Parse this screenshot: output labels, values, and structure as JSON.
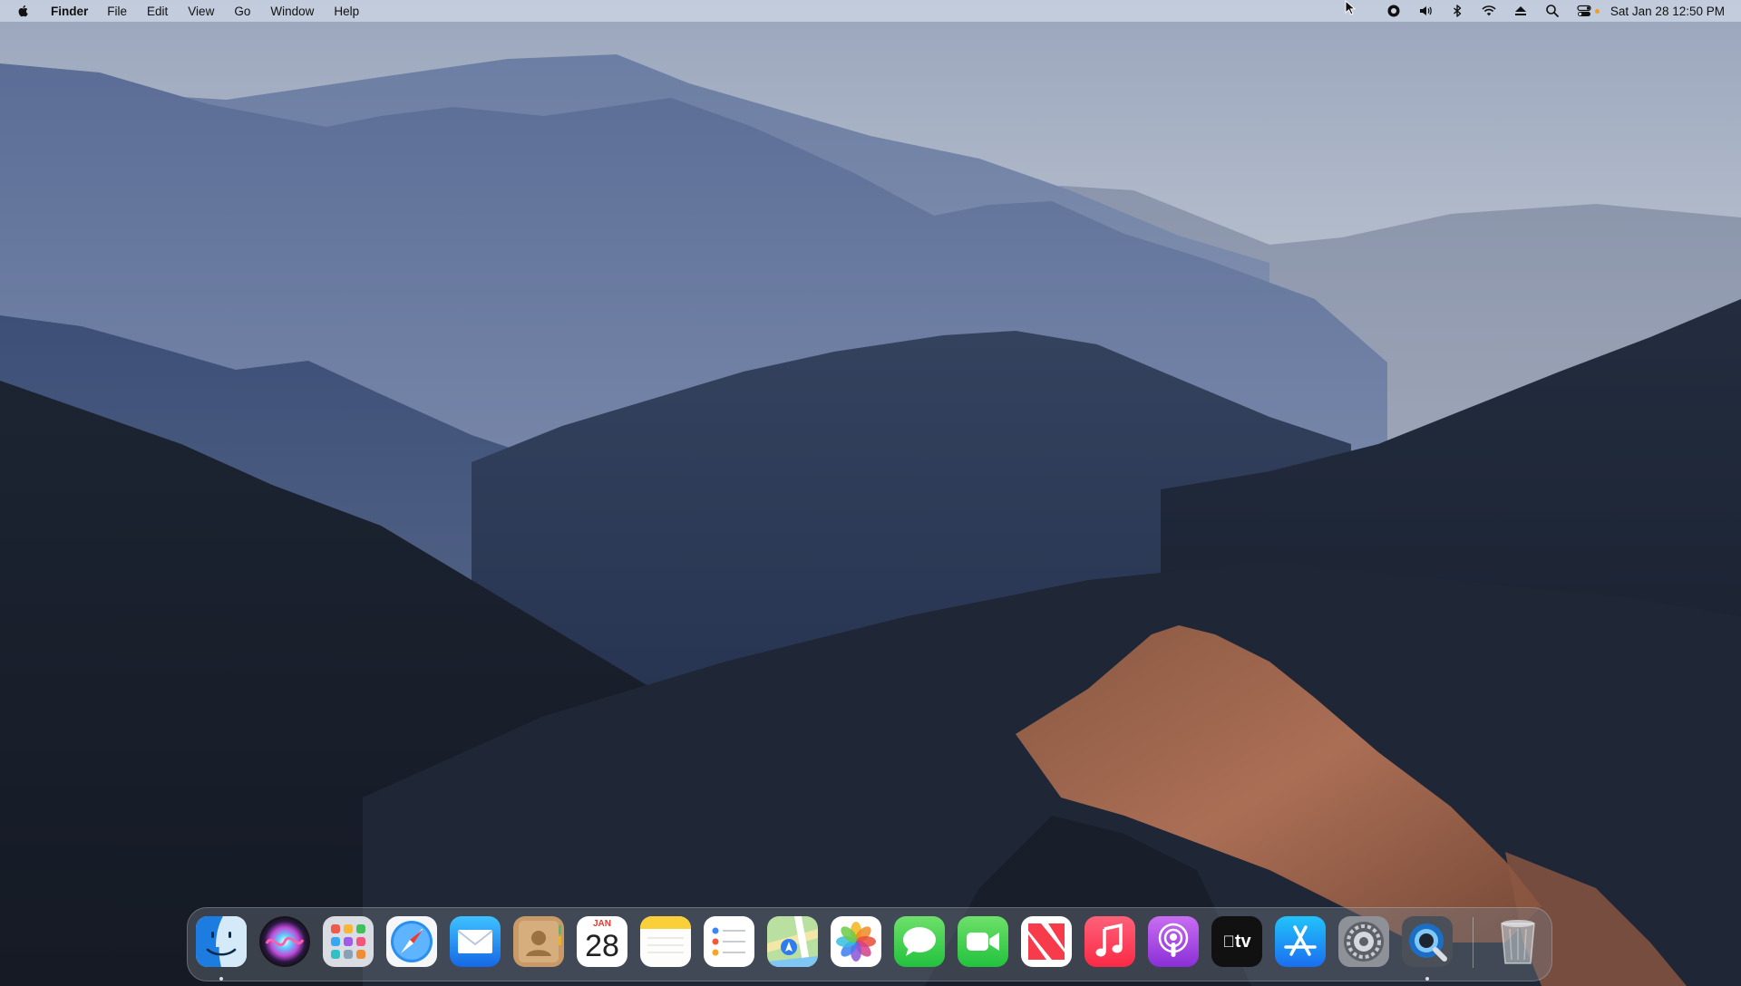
{
  "menubar": {
    "app_name": "Finder",
    "menus": [
      "File",
      "Edit",
      "View",
      "Go",
      "Window",
      "Help"
    ],
    "status_icons": [
      "screen-record-icon",
      "volume-icon",
      "bluetooth-icon",
      "wifi-icon",
      "eject-icon",
      "spotlight-search-icon",
      "control-center-icon"
    ],
    "clock": "Sat Jan 28  12:50 PM"
  },
  "dock": {
    "apps": [
      {
        "name": "Finder",
        "icon": "finder-icon",
        "running": true
      },
      {
        "name": "Siri",
        "icon": "siri-icon",
        "running": false
      },
      {
        "name": "Launchpad",
        "icon": "launchpad-icon",
        "running": false
      },
      {
        "name": "Safari",
        "icon": "safari-icon",
        "running": false
      },
      {
        "name": "Mail",
        "icon": "mail-icon",
        "running": false
      },
      {
        "name": "Contacts",
        "icon": "contacts-icon",
        "running": false
      },
      {
        "name": "Calendar",
        "icon": "calendar-icon",
        "running": false,
        "month": "JAN",
        "day": "28"
      },
      {
        "name": "Notes",
        "icon": "notes-icon",
        "running": false
      },
      {
        "name": "Reminders",
        "icon": "reminders-icon",
        "running": false
      },
      {
        "name": "Maps",
        "icon": "maps-icon",
        "running": false
      },
      {
        "name": "Photos",
        "icon": "photos-icon",
        "running": false
      },
      {
        "name": "Messages",
        "icon": "messages-icon",
        "running": false
      },
      {
        "name": "FaceTime",
        "icon": "facetime-icon",
        "running": false
      },
      {
        "name": "News",
        "icon": "news-icon",
        "running": false
      },
      {
        "name": "Music",
        "icon": "music-icon",
        "running": false
      },
      {
        "name": "Podcasts",
        "icon": "podcasts-icon",
        "running": false
      },
      {
        "name": "TV",
        "icon": "apple-tv-icon",
        "running": false,
        "label": "tv"
      },
      {
        "name": "App Store",
        "icon": "app-store-icon",
        "running": false
      },
      {
        "name": "System Settings",
        "icon": "system-settings-icon",
        "running": false
      },
      {
        "name": "QuickTime Player",
        "icon": "quicktime-icon",
        "running": true
      }
    ],
    "trash": {
      "name": "Trash",
      "icon": "trash-icon"
    }
  },
  "colors": {
    "menubar_bg": "#cdd6e4",
    "sky": "#b9c2cf",
    "sunlit_ridge": "#a9674a"
  }
}
